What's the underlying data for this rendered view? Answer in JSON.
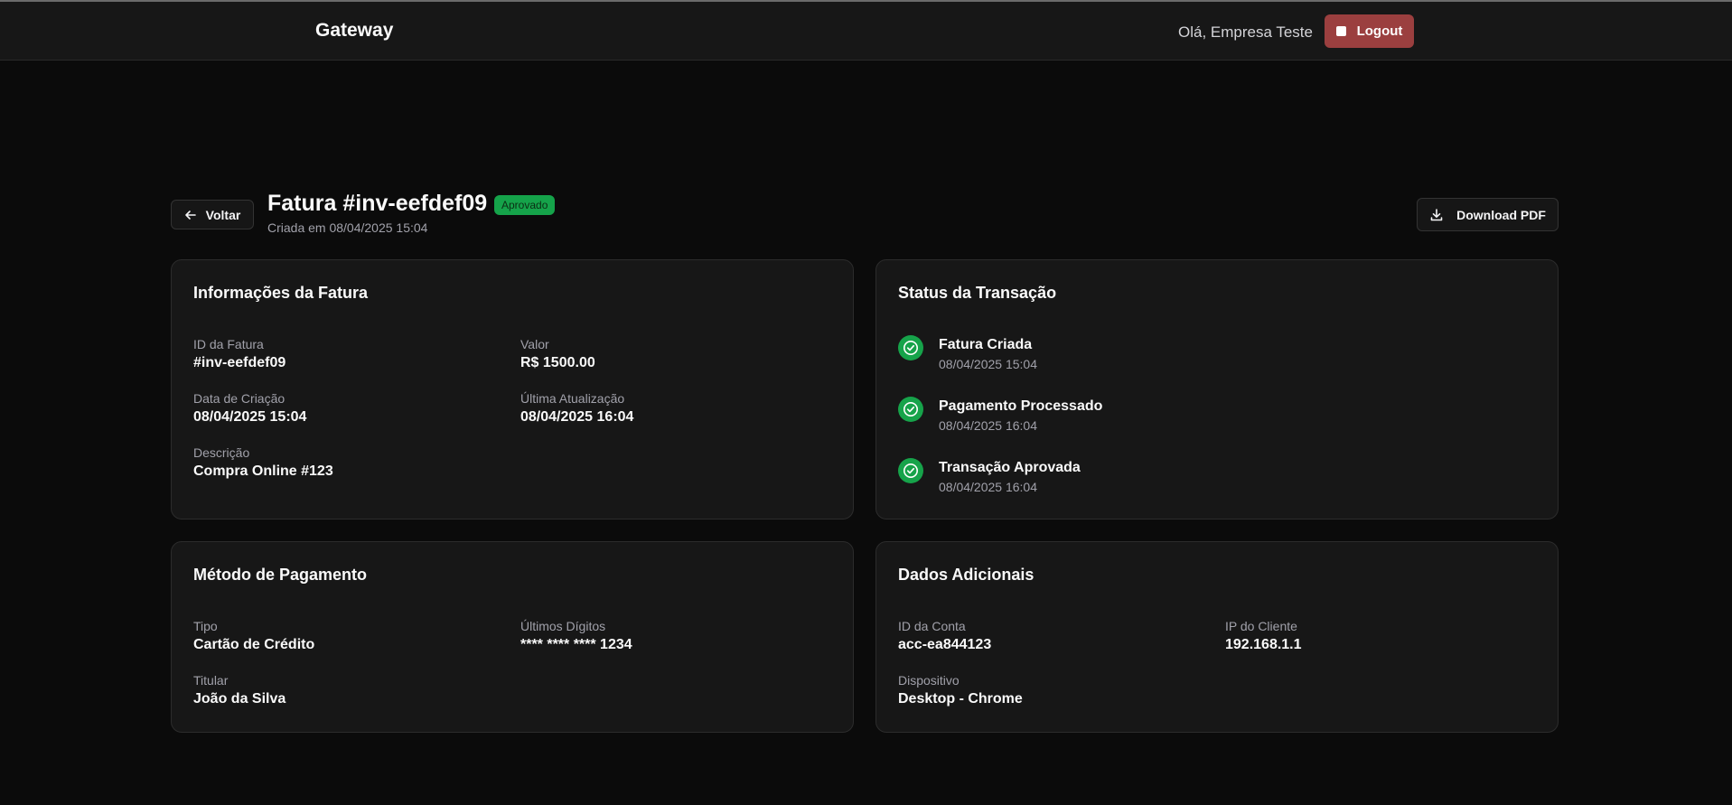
{
  "header": {
    "brand": "Gateway",
    "greeting": "Olá, Empresa Teste",
    "logout_label": "Logout"
  },
  "page": {
    "back_label": "Voltar",
    "title": "Fatura #inv-eefdef09",
    "status": "Aprovado",
    "created": "Criada em 08/04/2025 15:04",
    "download_label": "Download PDF"
  },
  "invoice_info": {
    "title": "Informações da Fatura",
    "fields": [
      {
        "label": "ID da Fatura",
        "value": "#inv-eefdef09"
      },
      {
        "label": "Valor",
        "value": "R$ 1500.00"
      },
      {
        "label": "Data de Criação",
        "value": "08/04/2025 15:04"
      },
      {
        "label": "Última Atualização",
        "value": "08/04/2025 16:04"
      },
      {
        "label": "Descrição",
        "value": "Compra Online #123"
      }
    ]
  },
  "transaction_status": {
    "title": "Status da Transação",
    "steps": [
      {
        "title": "Fatura Criada",
        "date": "08/04/2025 15:04"
      },
      {
        "title": "Pagamento Processado",
        "date": "08/04/2025 16:04"
      },
      {
        "title": "Transação Aprovada",
        "date": "08/04/2025 16:04"
      }
    ]
  },
  "payment_method": {
    "title": "Método de Pagamento",
    "fields": [
      {
        "label": "Tipo",
        "value": "Cartão de Crédito"
      },
      {
        "label": "Últimos Dígitos",
        "value": "**** **** **** 1234"
      },
      {
        "label": "Titular",
        "value": "João da Silva"
      }
    ]
  },
  "additional": {
    "title": "Dados Adicionais",
    "fields": [
      {
        "label": "ID da Conta",
        "value": "acc-ea844123"
      },
      {
        "label": "IP do Cliente",
        "value": "192.168.1.1"
      },
      {
        "label": "Dispositivo",
        "value": "Desktop - Chrome"
      }
    ]
  },
  "colors": {
    "background": "#0b0b0b",
    "card": "#171717",
    "success": "#16a34a",
    "danger": "#9b3f3f"
  },
  "icons": [
    "arrow-left-icon",
    "download-icon",
    "check-circle-icon",
    "logout-icon"
  ]
}
